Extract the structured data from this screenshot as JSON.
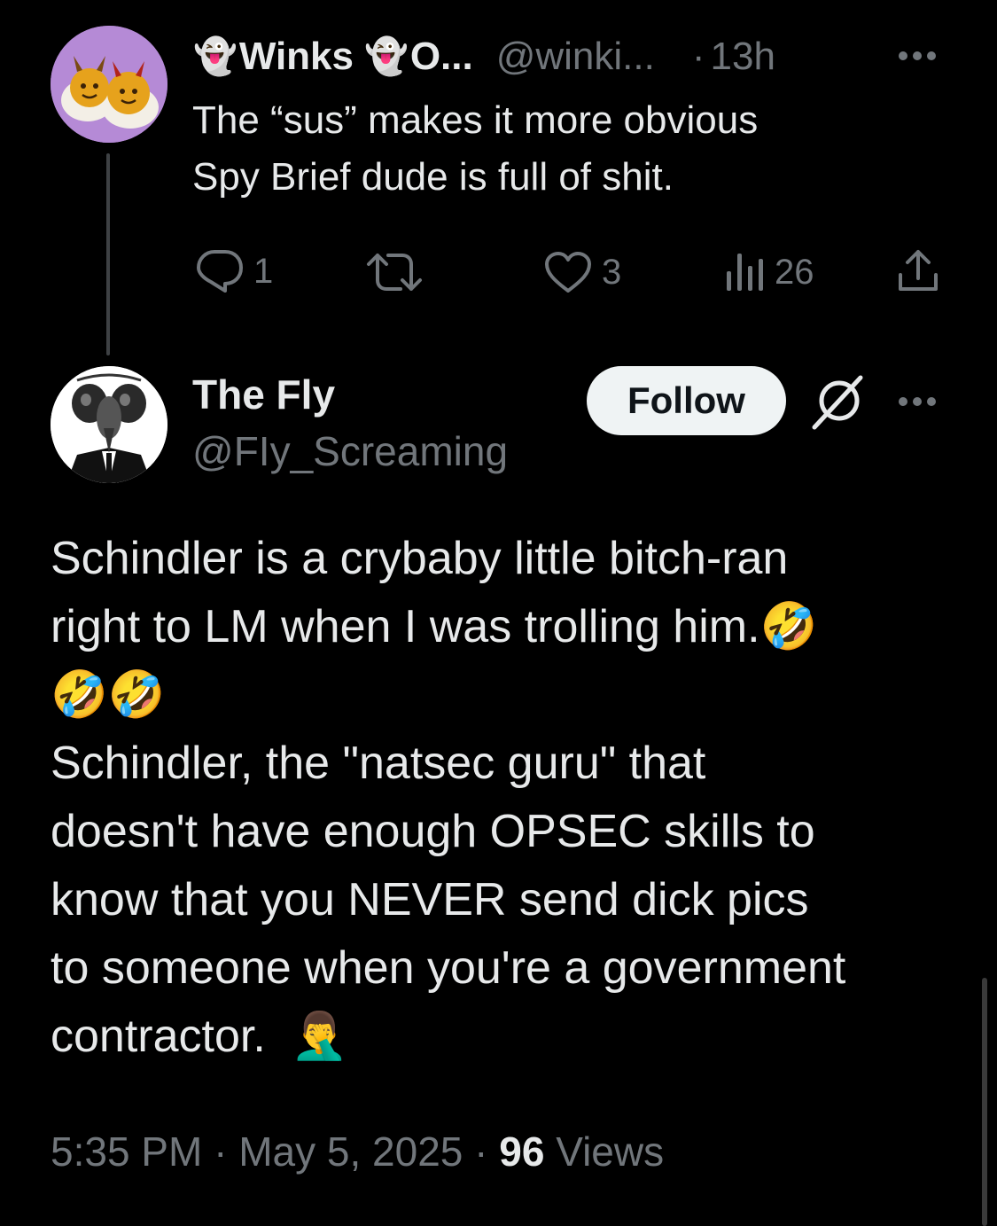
{
  "colors": {
    "background": "#000000",
    "primary_text": "#e7e9ea",
    "secondary_text": "#71767b",
    "follow_button_bg": "#eff3f4",
    "follow_button_text": "#0f1419",
    "thread_line": "#3e4144"
  },
  "parent_tweet": {
    "display_name": "Winks",
    "display_name_suffix": "O...",
    "name_emoji": "👻",
    "handle": "@winki...",
    "separator": "·",
    "time": "13h",
    "text_line1": "The “sus” makes it more obvious",
    "text_line2": "Spy Brief dude is full of shit.",
    "actions": {
      "replies": "1",
      "reposts": "",
      "likes": "3",
      "views": "26"
    },
    "icons": [
      "reply-icon",
      "repost-icon",
      "like-icon",
      "views-icon",
      "share-icon",
      "more-icon"
    ]
  },
  "main_tweet": {
    "display_name": "The Fly",
    "handle": "@FIy_Screaming",
    "follow_label": "Follow",
    "icons": [
      "grok-icon",
      "more-icon"
    ],
    "text": {
      "line1": "Schindler is a crybaby little bitch-ran",
      "line2": "right to LM when I was trolling him.",
      "laugh_emoji": "🤣",
      "line3": "Schindler, the \"natsec guru\" that",
      "line4": "doesn't have enough OPSEC skills to",
      "line5": "know that you NEVER send dick pics",
      "line6": "to someone when you're a government",
      "line7": "contractor.",
      "facepalm_emoji": "🤦‍♂️"
    },
    "meta": {
      "time": "5:35 PM",
      "separator": "·",
      "date": "May 5, 2025",
      "views_count": "96",
      "views_label": "Views"
    }
  }
}
